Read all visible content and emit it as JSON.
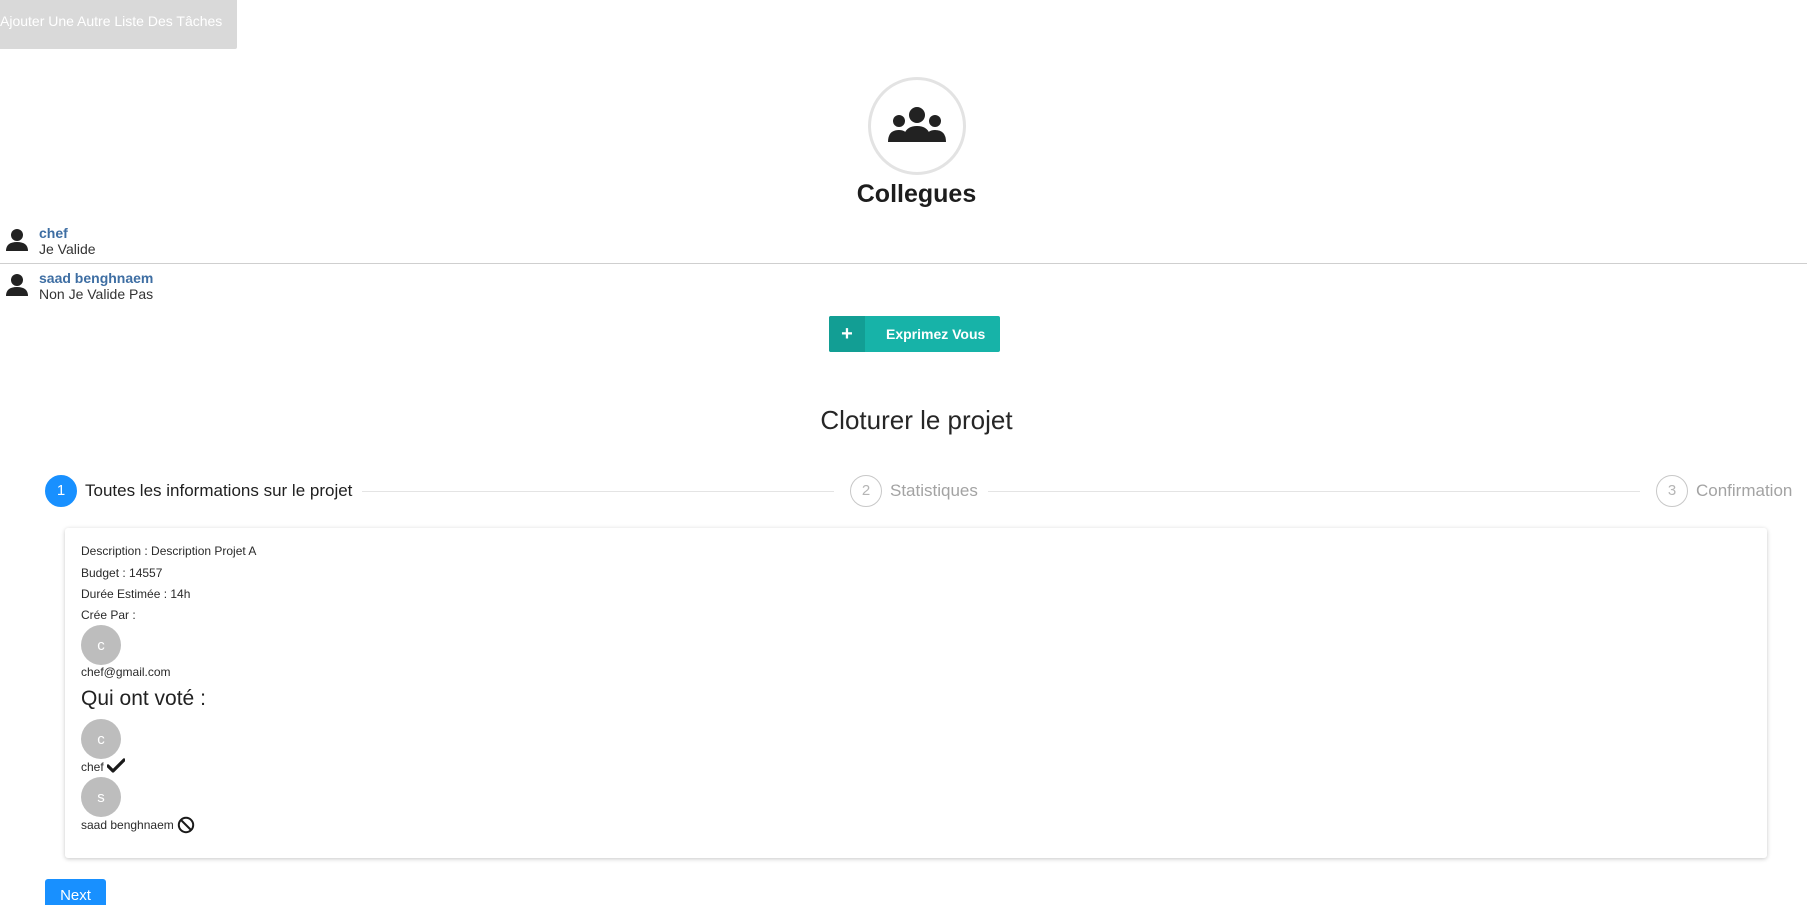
{
  "top_button": {
    "label": "Ajouter Une Autre Liste Des Tâches"
  },
  "group": {
    "title": "Collegues",
    "icon": "users-icon"
  },
  "members": [
    {
      "name": "chef",
      "status": "Je Valide"
    },
    {
      "name": "saad benghnaem",
      "status": "Non Je Valide Pas"
    }
  ],
  "express_button": {
    "label": "Exprimez Vous",
    "icon": "plus-icon"
  },
  "section": {
    "title": "Cloturer le projet"
  },
  "steps": [
    {
      "number": "1",
      "label": "Toutes les informations sur le projet",
      "state": "active"
    },
    {
      "number": "2",
      "label": "Statistiques",
      "state": "inactive"
    },
    {
      "number": "3",
      "label": "Confirmation",
      "state": "inactive"
    }
  ],
  "project": {
    "description": "Description : Description Projet A",
    "budget": "Budget : 14557",
    "duration": "Durée Estimée : 14h",
    "created_by_label": "Crée Par :",
    "creator_initial": "c",
    "creator_email": "chef@gmail.com"
  },
  "voters": {
    "title": "Qui ont voté :",
    "items": [
      {
        "initial": "c",
        "name": "chef",
        "vote_icon": "check-icon"
      },
      {
        "initial": "s",
        "name": "saad benghnaem",
        "vote_icon": "ban-icon"
      }
    ]
  },
  "next_button": {
    "label": "Next"
  },
  "colors": {
    "primary": "#1890ff",
    "teal": "#17b3a8",
    "member_name": "#3e6ea3",
    "avatar": "#bdbdbd"
  }
}
